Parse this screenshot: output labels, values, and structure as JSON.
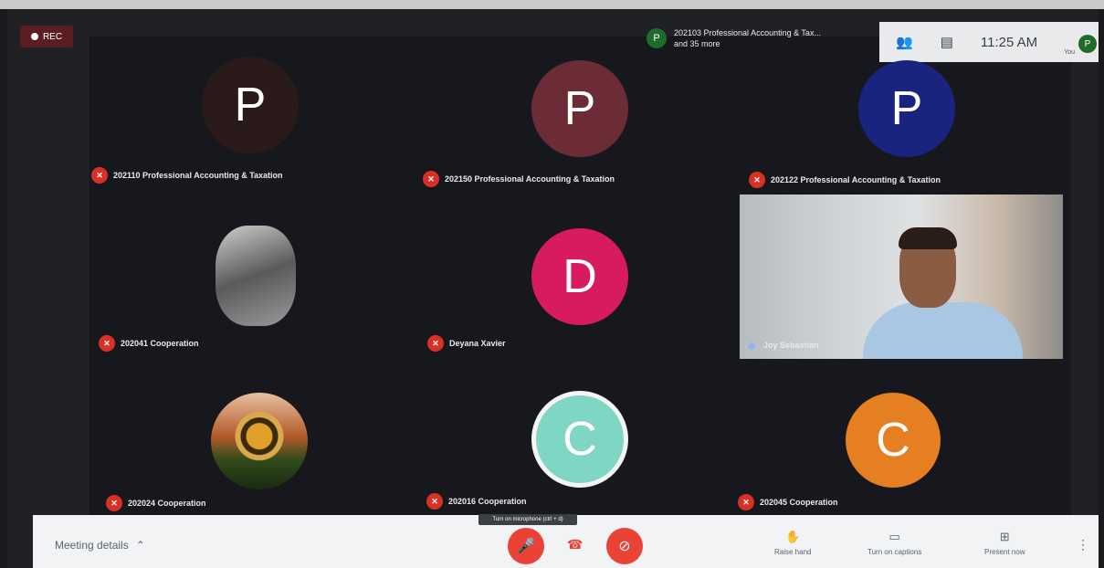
{
  "rec": {
    "label": "REC"
  },
  "top_info": {
    "avatar_letter": "P",
    "line1": "202103 Professional Accounting & Tax...",
    "line2": "and 35 more"
  },
  "top_bar": {
    "people_icon": "people-icon",
    "chat_icon": "chat-icon",
    "time": "11:25 AM",
    "self_avatar": "P",
    "self_label": "You"
  },
  "tiles": [
    {
      "letter": "P",
      "color": "#2a1a1a",
      "name": "202110 Professional Accounting & Taxation"
    },
    {
      "letter": "P",
      "color": "#6b2c35",
      "name": "202150 Professional Accounting & Taxation"
    },
    {
      "letter": "P",
      "color": "#1a237e",
      "name": "202122 Professional Accounting & Taxation"
    },
    {
      "letter": "",
      "color": "#7e7e7e",
      "name": "202041 Cooperation"
    },
    {
      "letter": "D",
      "color": "#d81b60",
      "name": "Deyana Xavier"
    },
    {
      "letter": "",
      "color": "",
      "name": "Joy Sebastian"
    },
    {
      "letter": "",
      "color": "#b45a2a",
      "name": "202024 Cooperation"
    },
    {
      "letter": "C",
      "color": "#7fd6c4",
      "name": "202016 Cooperation"
    },
    {
      "letter": "C",
      "color": "#e67e22",
      "name": "202045 Cooperation"
    }
  ],
  "tooltip": "Turn on microphone (ctrl + d)",
  "bottom_bar": {
    "meeting_details": "Meeting details",
    "raise_hand": "Raise hand",
    "captions": "Turn on captions",
    "present": "Present now"
  }
}
